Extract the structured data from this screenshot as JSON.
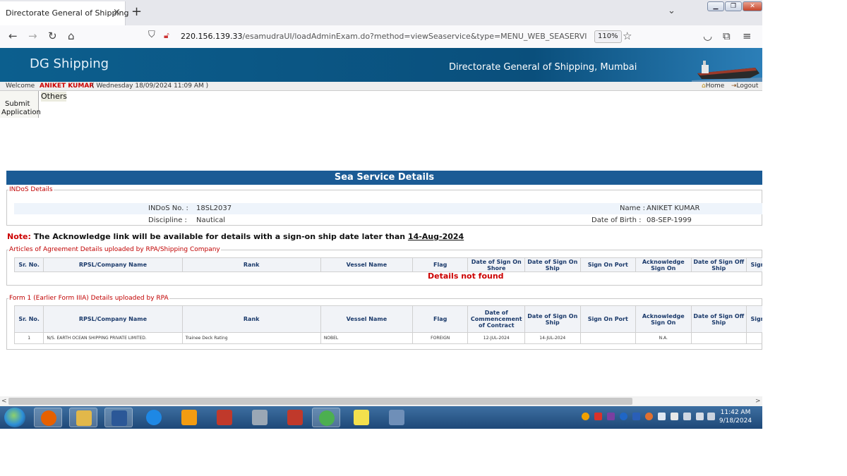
{
  "browser": {
    "tab_title": "Directorate General of Shipping",
    "tab_close": "×",
    "new_tab": "+",
    "tab_list_icon": "chevron-down-icon",
    "url_host": "220.156.139.33",
    "url_path": "/esamudraUI/loadAdminExam.do?method=viewSeaservice&type=MENU_WEB_SEASERVICE&userName=",
    "zoom": "110%",
    "nav_icons": [
      "back-arrow-icon",
      "forward-arrow-icon",
      "reload-icon",
      "home-icon",
      "shield-icon",
      "lock-icon",
      "star-icon",
      "pocket-icon",
      "extensions-icon",
      "menu-icon"
    ]
  },
  "site": {
    "title": "DG Shipping",
    "subtitle": "Directorate General of Shipping, Mumbai",
    "welcome_label": "Welcome",
    "user_name": "ANIKET KUMAR",
    "datetime": "( Wednesday 18/09/2024 11:09 AM )",
    "home_link": "Home",
    "logout_link": "Logout"
  },
  "menu": {
    "submit_line1": "Submit",
    "submit_line2": "Application",
    "others": "Others"
  },
  "page": {
    "section_title": "Sea Service Details"
  },
  "indos": {
    "legend": "INDoS Details",
    "indos_label": "INDoS No. :",
    "indos_value": "18SL2037",
    "name_label": "Name :",
    "name_value": "ANIKET KUMAR",
    "discipline_label": "Discipline :",
    "discipline_value": "Nautical",
    "dob_label": "Date of Birth :",
    "dob_value": "08-SEP-1999"
  },
  "note": {
    "label": "Note:",
    "text": "The Acknowledge link will be available for details with a sign-on ship date later than",
    "date": "14-Aug-2024"
  },
  "aoa": {
    "legend": "Articles of Agreement Details uploaded by RPA/Shipping Company",
    "headers": [
      "Sr. No.",
      "RPSL/Company Name",
      "Rank",
      "Vessel Name",
      "Flag",
      "Date of Sign On Shore",
      "Date of Sign On Ship",
      "Sign On Port",
      "Acknowledge Sign On",
      "Date of Sign Off Ship",
      "Sign Off Po"
    ],
    "empty_message": "Details not found"
  },
  "form1": {
    "legend": "Form 1 (Earlier Form IIIA) Details uploaded by RPA",
    "headers": [
      "Sr. No.",
      "RPSL/Company Name",
      "Rank",
      "Vessel Name",
      "Flag",
      "Date of Commencement of Contract",
      "Date of Sign On Ship",
      "Sign On Port",
      "Acknowledge Sign On",
      "Date of Sign Off Ship",
      "Sign Off Po"
    ],
    "rows": [
      [
        "1",
        "N/S. EARTH OCEAN SHIPPING PRIVATE LIMITED.",
        "Trainee Deck Rating",
        "NOBEL",
        "FOREIGN",
        "12-JUL-2024",
        "14-JUL-2024",
        "",
        "N.A.",
        "",
        ""
      ]
    ]
  },
  "taskbar": {
    "items": [
      "firefox-icon",
      "file-explorer-icon",
      "word-icon",
      "internet-explorer-icon",
      "media-player-icon",
      "pdf-reader-icon",
      "calculator-icon",
      "photo-app-icon",
      "chrome-icon",
      "sticky-notes-icon",
      "snipping-tool-icon"
    ],
    "time": "11:42 AM",
    "date": "9/18/2024"
  }
}
